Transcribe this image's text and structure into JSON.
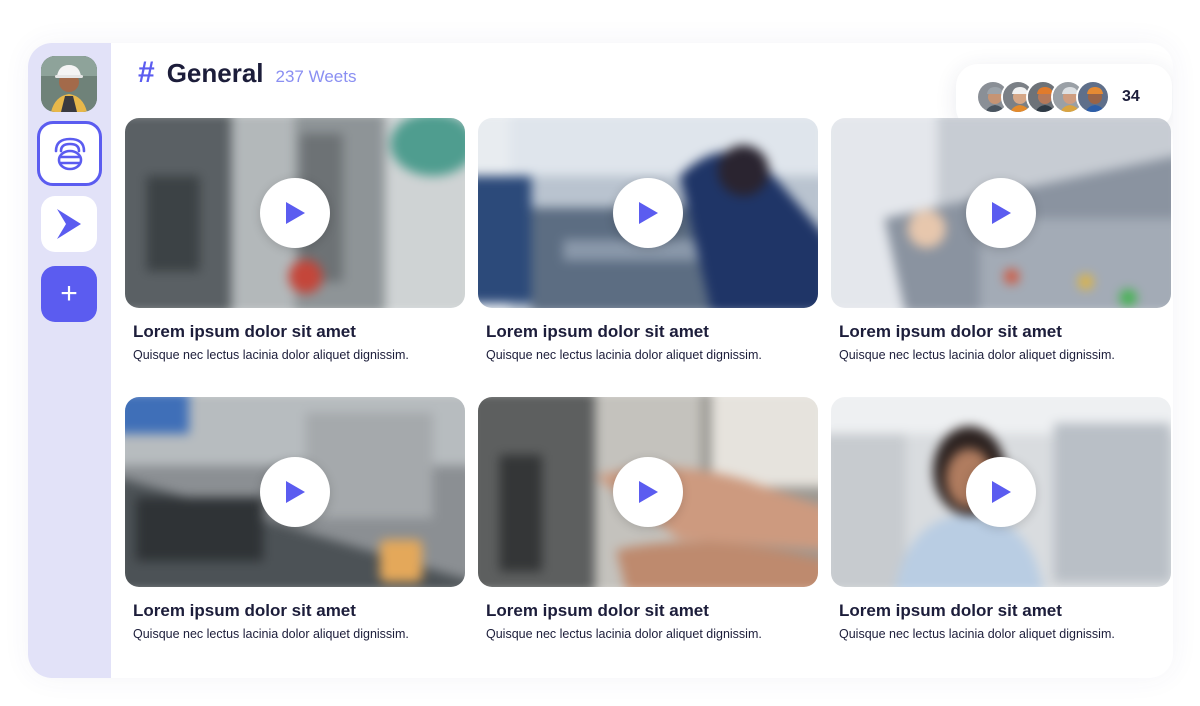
{
  "channel": {
    "hash_symbol": "#",
    "name": "General",
    "count_label": "237 Weets"
  },
  "sidebar": {
    "items": [
      {
        "icon": "user-avatar",
        "active": false
      },
      {
        "icon": "hive-logo-icon",
        "active": true
      },
      {
        "icon": "play-logo-icon",
        "active": false
      },
      {
        "icon": "plus-icon",
        "label": "+"
      }
    ]
  },
  "members": {
    "count": "34",
    "avatars": [
      "member-1",
      "member-2",
      "member-3",
      "member-4",
      "member-5"
    ]
  },
  "videos": [
    {
      "title": "Lorem ipsum dolor sit amet",
      "description": "Quisque nec lectus lacinia dolor aliquet dignissim."
    },
    {
      "title": "Lorem ipsum dolor sit amet",
      "description": "Quisque nec lectus lacinia dolor aliquet dignissim."
    },
    {
      "title": "Lorem ipsum dolor sit amet",
      "description": "Quisque nec lectus lacinia dolor aliquet dignissim."
    },
    {
      "title": "Lorem ipsum dolor sit amet",
      "description": "Quisque nec lectus lacinia dolor aliquet dignissim."
    },
    {
      "title": "Lorem ipsum dolor sit amet",
      "description": "Quisque nec lectus lacinia dolor aliquet dignissim."
    },
    {
      "title": "Lorem ipsum dolor sit amet",
      "description": "Quisque nec lectus lacinia dolor aliquet dignissim."
    }
  ],
  "colors": {
    "accent": "#5b5cf0",
    "sidebar_bg": "#e2e2f8",
    "text_dark": "#1c1d3a",
    "count_text": "#8a8ff2"
  }
}
